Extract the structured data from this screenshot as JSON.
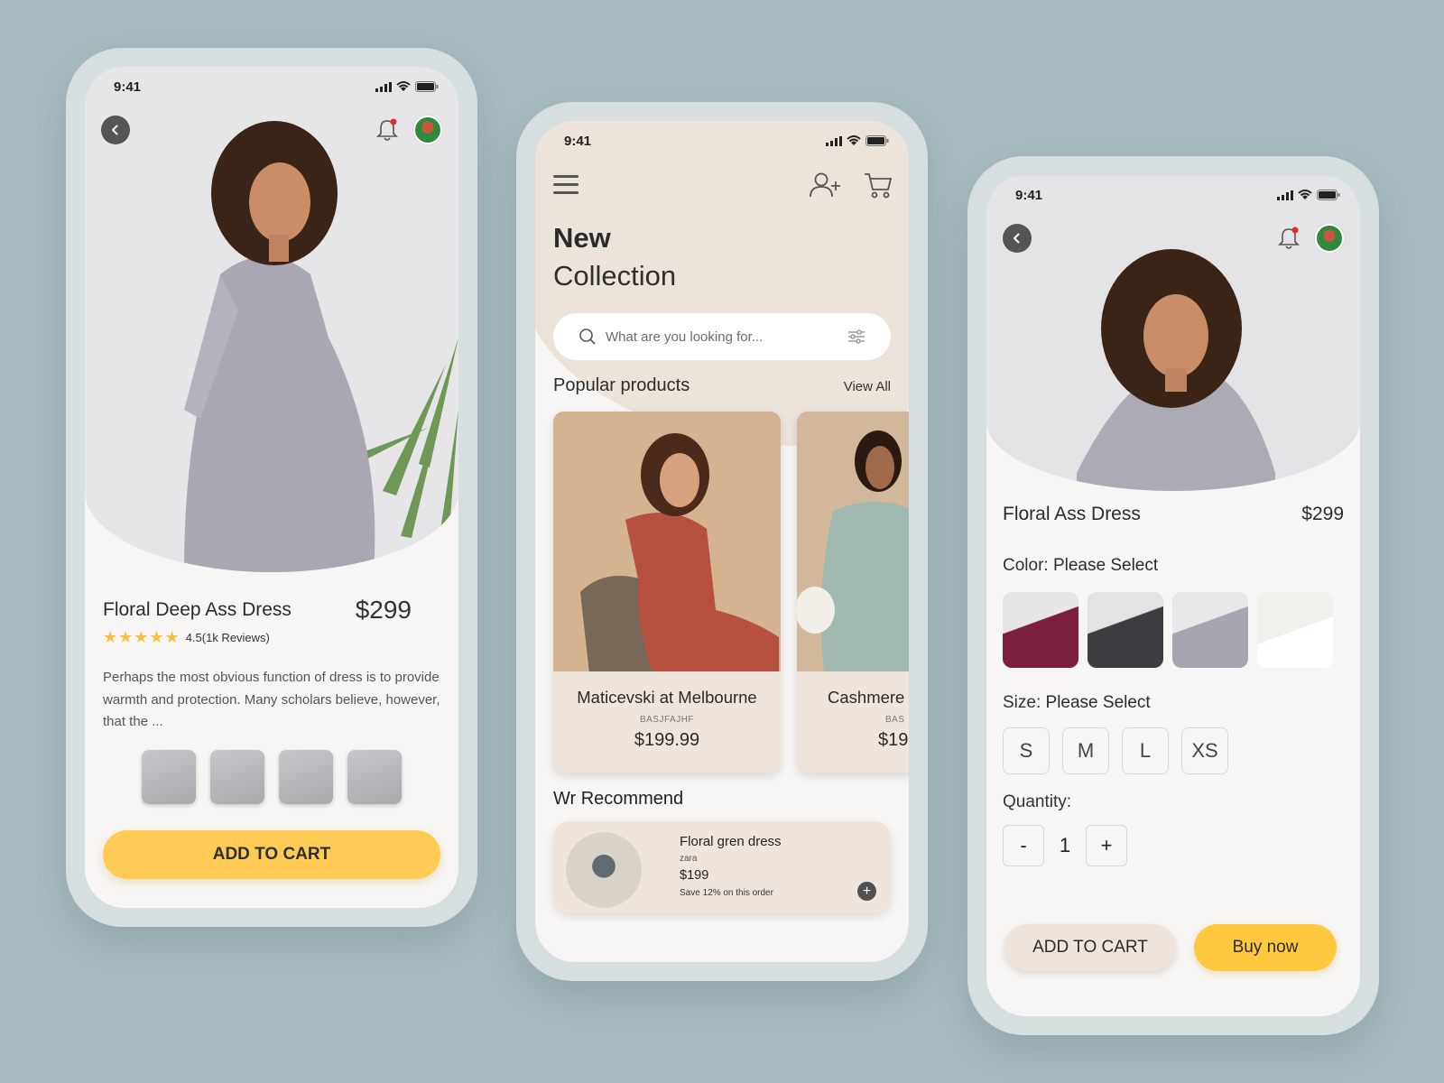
{
  "colors": {
    "background": "#a7babf",
    "device_frame": "#d6dee0",
    "screen": "#f8f6f4",
    "beige": "#efe5dd",
    "accent_yellow": "#ffcb54",
    "star": "#f4c142",
    "notification_dot": "#e32a2a"
  },
  "status_bar": {
    "time": "9:41"
  },
  "phone1": {
    "product_title": "Floral Deep Ass Dress",
    "price": "$299",
    "stars": "★★★★★",
    "rating_text": "4.5(1k Reviews)",
    "description": "Perhaps the most obvious function of dress is to provide warmth and protection. Many scholars believe, however, that the ...",
    "thumbnails": [
      "thumb-1",
      "thumb-2",
      "thumb-3",
      "thumb-4"
    ],
    "cta_label": "ADD TO CART",
    "icons": [
      "back-icon",
      "bell-icon",
      "avatar"
    ]
  },
  "phone2": {
    "heading_bold": "New",
    "heading_light": "Collection",
    "search_placeholder": "What are you looking for...",
    "popular_title": "Popular products",
    "view_all": "View All",
    "products": [
      {
        "name": "Maticevski at Melbourne",
        "sku": "BASJFAJHF",
        "price": "$199.99"
      },
      {
        "name": "Cashmere",
        "sku": "BAS",
        "price": "$19"
      }
    ],
    "recommend_title": "Wr Recommend",
    "recommend": {
      "name": "Floral gren dress",
      "brand": "zara",
      "price": "$199",
      "note": "Save 12% on this order",
      "add_symbol": "+"
    },
    "icons": [
      "menu-icon",
      "add-user-icon",
      "cart-icon",
      "search-icon",
      "filter-icon"
    ]
  },
  "phone3": {
    "product_title": "Floral Ass Dress",
    "price": "$299",
    "color_label": "Color:",
    "color_value": "Please Select",
    "size_label": "Size:",
    "size_value": "Please Select",
    "sizes": [
      "S",
      "M",
      "L",
      "XS"
    ],
    "quantity_label": "Quantity:",
    "quantity_minus": "-",
    "quantity_value": "1",
    "quantity_plus": "+",
    "add_to_cart": "ADD TO CART",
    "buy_now": "Buy now"
  }
}
